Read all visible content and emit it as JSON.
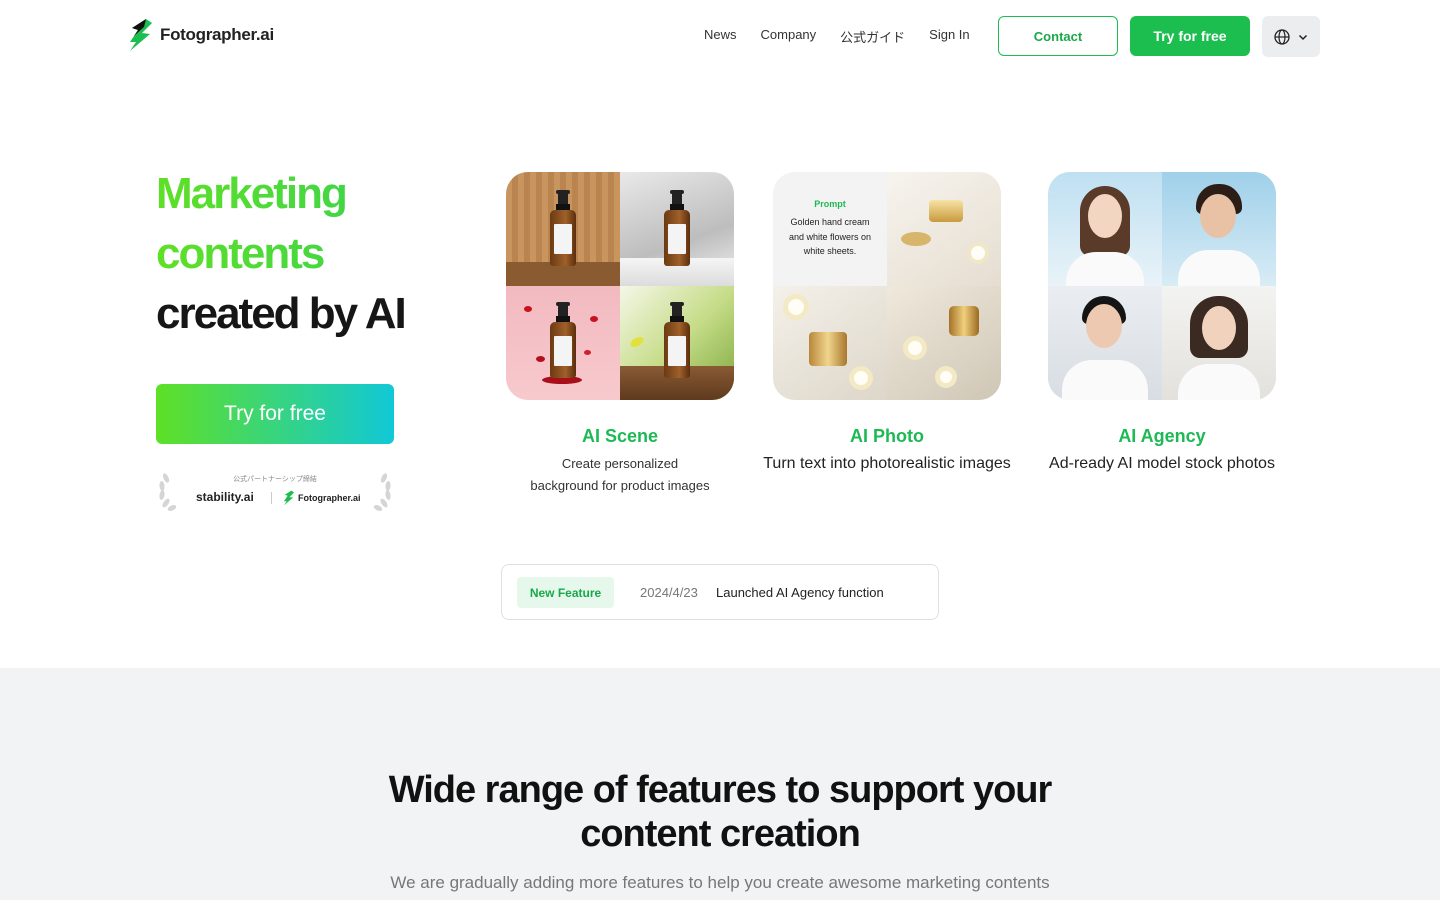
{
  "header": {
    "brand": "Fotographer.ai",
    "nav": [
      "News",
      "Company",
      "公式ガイド",
      "Sign In"
    ],
    "contact_label": "Contact",
    "try_label": "Try for free"
  },
  "hero": {
    "title_line1": "Marketing",
    "title_line2": "contents",
    "title_line3": "created by AI",
    "cta_label": "Try for free",
    "partner_caption": "公式パートナーシップ締結",
    "partner_a": "stability.ai",
    "partner_b": "Fotographer.ai"
  },
  "cards": [
    {
      "title": "AI Scene",
      "desc_line1": "Create personalized",
      "desc_line2": "background for product images"
    },
    {
      "title": "AI Photo",
      "desc": "Turn text into photorealistic images",
      "prompt_label": "Prompt",
      "prompt_text": "Golden hand cream and white flowers on white sheets."
    },
    {
      "title": "AI Agency",
      "desc": "Ad-ready AI model stock photos"
    }
  ],
  "news": {
    "badge": "New Feature",
    "date": "2024/4/23",
    "text": "Launched AI Agency function"
  },
  "features": {
    "title_line1": "Wide range of features to support your",
    "title_line2": "content creation",
    "subtitle": "We are gradually adding more features to help you create awesome marketing contents"
  },
  "colors": {
    "brand_green": "#1cbe4f",
    "gradient_start": "#5fe026",
    "gradient_end": "#11c8d6"
  }
}
